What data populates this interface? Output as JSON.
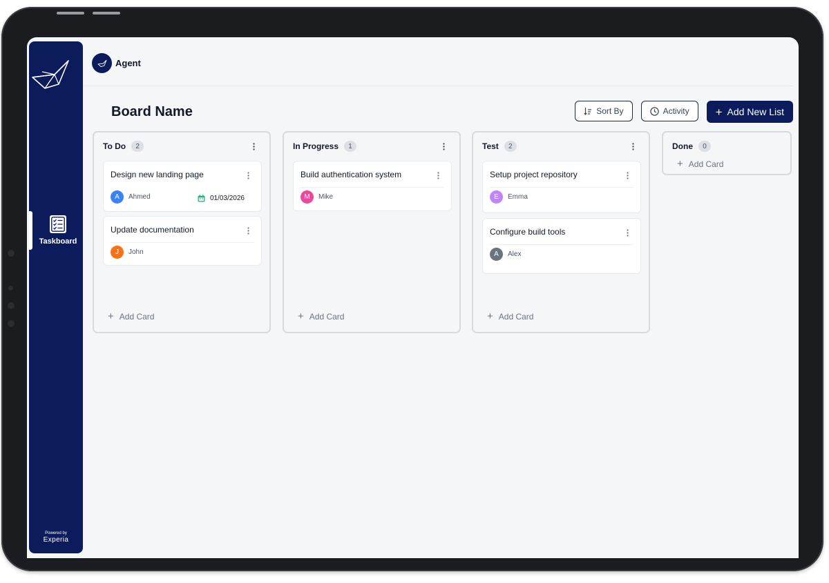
{
  "app": {
    "agent_name": "Agent",
    "powered_by": "Powered by",
    "brand": "Experia"
  },
  "sidebar": {
    "items": [
      {
        "label": "Taskboard",
        "icon": "checklist-icon",
        "active": true
      }
    ]
  },
  "board": {
    "title": "Board Name",
    "sort_label": "Sort By",
    "activity_label": "Activity",
    "add_list_label": "Add New List",
    "add_card_label": "Add Card",
    "lists": [
      {
        "title": "To Do",
        "count": "2",
        "cards": [
          {
            "title": "Design new landing page",
            "assignee": "Ahmed",
            "initial": "A",
            "avatar_color": "#3b82f6",
            "due": "01/03/2026"
          },
          {
            "title": "Update documentation",
            "assignee": "John",
            "initial": "J",
            "avatar_color": "#f97316"
          }
        ]
      },
      {
        "title": "In Progress",
        "count": "1",
        "cards": [
          {
            "title": "Build authentication system",
            "assignee": "Mike",
            "initial": "M",
            "avatar_color": "#ec4899"
          }
        ]
      },
      {
        "title": "Test",
        "count": "2",
        "cards": [
          {
            "title": "Setup project repository",
            "assignee": "Emma",
            "initial": "E",
            "avatar_color": "#c084fc"
          },
          {
            "title": "Configure build tools",
            "assignee": "Alex",
            "initial": "A",
            "avatar_color": "#6b7280"
          }
        ]
      },
      {
        "title": "Done",
        "count": "0",
        "cards": []
      }
    ]
  },
  "colors": {
    "sidebar": "#0c1b5c",
    "primary": "#0c1b5c",
    "background": "#f5f6f8",
    "calendar": "#10b981"
  }
}
